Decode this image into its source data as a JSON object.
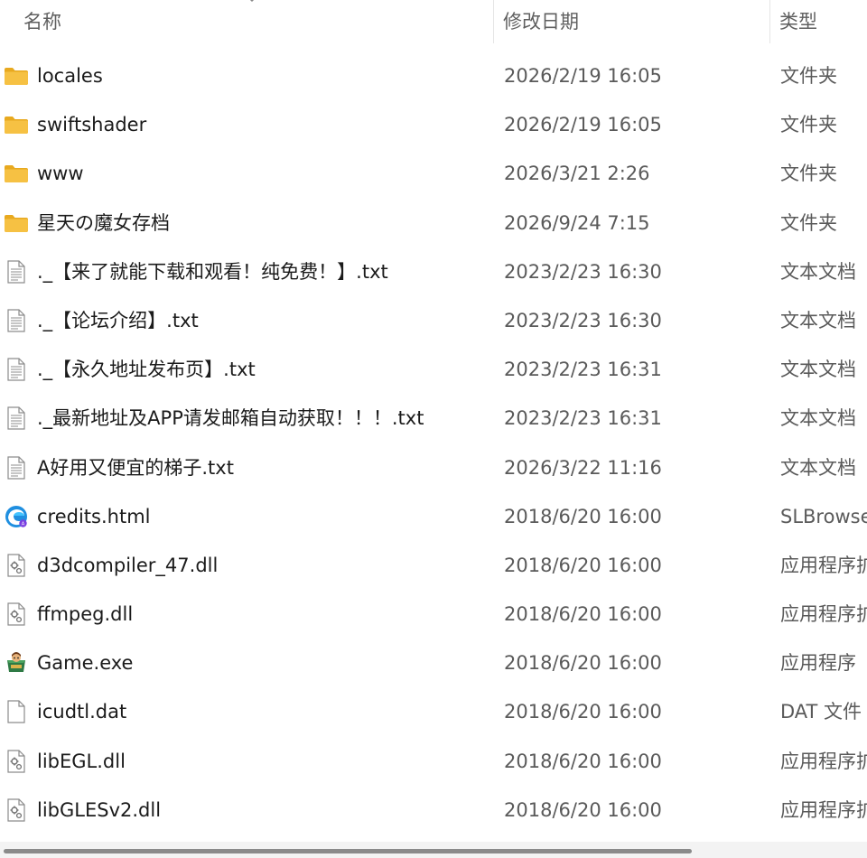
{
  "columns": {
    "name": "名称",
    "date": "修改日期",
    "type": "类型"
  },
  "files": [
    {
      "name": "locales",
      "date": "2026/2/19 16:05",
      "type": "文件夹",
      "icon": "folder-icon"
    },
    {
      "name": "swiftshader",
      "date": "2026/2/19 16:05",
      "type": "文件夹",
      "icon": "folder-icon"
    },
    {
      "name": "www",
      "date": "2026/3/21 2:26",
      "type": "文件夹",
      "icon": "folder-icon"
    },
    {
      "name": "星天の魔女存档",
      "date": "2026/9/24 7:15",
      "type": "文件夹",
      "icon": "folder-icon"
    },
    {
      "name": "._【来了就能下载和观看！纯免费！】.txt",
      "date": "2023/2/23 16:30",
      "type": "文本文档",
      "icon": "text-file-icon"
    },
    {
      "name": "._【论坛介绍】.txt",
      "date": "2023/2/23 16:30",
      "type": "文本文档",
      "icon": "text-file-icon"
    },
    {
      "name": "._【永久地址发布页】.txt",
      "date": "2023/2/23 16:31",
      "type": "文本文档",
      "icon": "text-file-icon"
    },
    {
      "name": "._最新地址及APP请发邮箱自动获取！！！.txt",
      "date": "2023/2/23 16:31",
      "type": "文本文档",
      "icon": "text-file-icon"
    },
    {
      "name": "A好用又便宜的梯子.txt",
      "date": "2026/3/22 11:16",
      "type": "文本文档",
      "icon": "text-file-icon"
    },
    {
      "name": "credits.html",
      "date": "2018/6/20 16:00",
      "type": "SLBrowse",
      "icon": "browser-html-icon"
    },
    {
      "name": "d3dcompiler_47.dll",
      "date": "2018/6/20 16:00",
      "type": "应用程序扩",
      "icon": "dll-file-icon"
    },
    {
      "name": "ffmpeg.dll",
      "date": "2018/6/20 16:00",
      "type": "应用程序扩",
      "icon": "dll-file-icon"
    },
    {
      "name": "Game.exe",
      "date": "2018/6/20 16:00",
      "type": "应用程序",
      "icon": "game-exe-icon"
    },
    {
      "name": "icudtl.dat",
      "date": "2018/6/20 16:00",
      "type": "DAT 文件",
      "icon": "blank-file-icon"
    },
    {
      "name": "libEGL.dll",
      "date": "2018/6/20 16:00",
      "type": "应用程序扩",
      "icon": "dll-file-icon"
    },
    {
      "name": "libGLESv2.dll",
      "date": "2018/6/20 16:00",
      "type": "应用程序扩",
      "icon": "dll-file-icon"
    }
  ],
  "colors": {
    "folder": "#f6c143",
    "folder_dark": "#e8a91f",
    "scroll_thumb": "#8a8a8a"
  }
}
